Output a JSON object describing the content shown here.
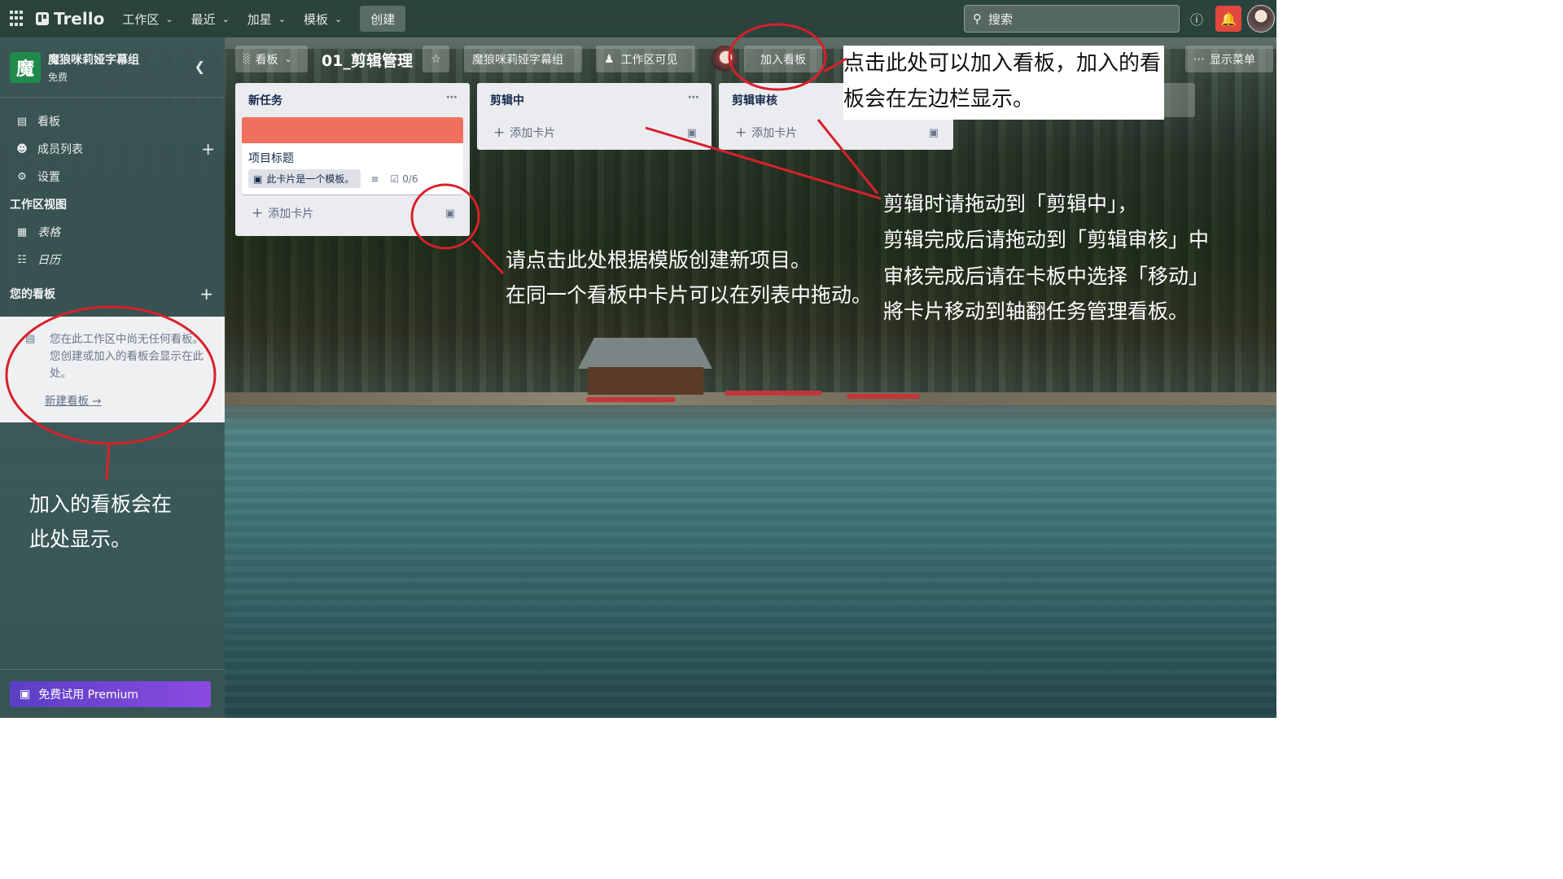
{
  "topbar": {
    "logo": "Trello",
    "nav": [
      {
        "label": "工作区"
      },
      {
        "label": "最近"
      },
      {
        "label": "加星"
      },
      {
        "label": "模板"
      }
    ],
    "create_label": "创建",
    "search_placeholder": "搜索"
  },
  "sidebar": {
    "workspace_initial": "魔",
    "workspace_name": "魔狼咪莉娅字幕组",
    "workspace_plan": "免费",
    "items": [
      {
        "label": "看板",
        "icon": "board-icon"
      },
      {
        "label": "成员列表",
        "icon": "person-icon"
      },
      {
        "label": "设置",
        "icon": "gear-icon"
      }
    ],
    "views_title": "工作区视图",
    "views": [
      {
        "label": "表格",
        "icon": "table-icon"
      },
      {
        "label": "日历",
        "icon": "calendar-icon"
      }
    ],
    "boards_title": "您的看板",
    "empty_text": "您在此工作区中尚无任何看板。您创建或加入的看板会显示在此处。",
    "new_board": "新建看板",
    "premium_label": "免费试用 Premium"
  },
  "board": {
    "view_label": "看板",
    "title": "01_剪辑管理",
    "workspace_label": "魔狼咪莉娅字幕组",
    "visibility_label": "工作区可见",
    "join_label": "加入看板",
    "menu_label": "显示菜单",
    "lists": [
      {
        "title": "新任务",
        "card": {
          "title": "项目标题",
          "template_badge": "此卡片是一个模板。",
          "checklist": "0/6",
          "cover_color": "#f0705d"
        },
        "add_label": "添加卡片"
      },
      {
        "title": "剪辑中",
        "add_label": "添加卡片"
      },
      {
        "title": "剪辑审核",
        "add_label": "添加卡片"
      }
    ]
  },
  "annotations": {
    "join_note": [
      "点击此处可以加入看板，加入的看",
      "板会在左边栏显示。"
    ],
    "template_note": [
      "请点击此处根据模版创建新项目。",
      "在同一个看板中卡片可以在列表中拖动。"
    ],
    "flow_note": [
      "剪辑时请拖动到「剪辑中」，",
      "剪辑完成后请拖动到「剪辑审核」中",
      "审核完成后请在卡板中选择「移动」",
      "將卡片移动到轴翻任务管理看板。"
    ],
    "sidebar_note": [
      "加入的看板会在",
      "此处显示。"
    ],
    "circle_color": "#d8202a"
  }
}
